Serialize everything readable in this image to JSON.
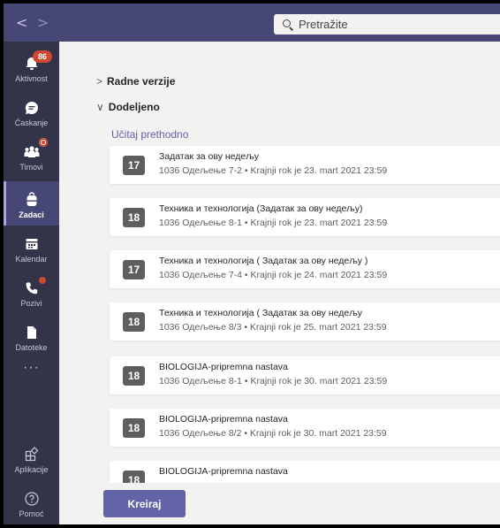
{
  "search": {
    "placeholder": "Pretražite"
  },
  "rail": {
    "activity": {
      "label": "Aktivnost",
      "badge": "86"
    },
    "chat": {
      "label": "Ćaskanje"
    },
    "teams": {
      "label": "Timovi"
    },
    "assignments": {
      "label": "Zadaci"
    },
    "calendar": {
      "label": "Kalendar"
    },
    "calls": {
      "label": "Pozivi"
    },
    "files": {
      "label": "Datoteke"
    },
    "more": "···",
    "apps": {
      "label": "Aplikacije"
    },
    "help": {
      "label": "Pomoć"
    }
  },
  "main": {
    "drafts_label": "Radne verzije",
    "assigned_label": "Dodeljeno",
    "load_previous": "Učitaj prethodno",
    "assignments": [
      {
        "num": "17",
        "title": "Задатак за ову недељу",
        "sub": "1036 Одељење 7-2 • Krajnji rok je 23. mart 2021 23:59"
      },
      {
        "num": "18",
        "title": "Техника и технологија (Задатак за ову недељу)",
        "sub": "1036 Одељење 8-1 • Krajnji rok je 23. mart 2021 23:59"
      },
      {
        "num": "17",
        "title": "Техника и технологија ( Задатак за ову недељу )",
        "sub": "1036 Одељење 7-4 • Krajnji rok je 24. mart 2021 23:59"
      },
      {
        "num": "18",
        "title": "Техника и технологија ( Задатак за ову недељу",
        "sub": "1036 Одељење 8/3 • Krajnji rok je 25. mart 2021 23:59"
      },
      {
        "num": "18",
        "title": "BIOLOGIJA-pripremna nastava",
        "sub": "1036 Одељење 8-1 • Krajnji rok je 30. mart 2021 23:59"
      },
      {
        "num": "18",
        "title": "BIOLOGIJA-pripremna nastava",
        "sub": "1036 Одељење 8/2 • Krajnji rok je 30. mart 2021 23:59"
      },
      {
        "num": "18",
        "title": "BIOLOGIJA-pripremna nastava",
        "sub": ""
      }
    ],
    "create_label": "Kreiraj"
  }
}
